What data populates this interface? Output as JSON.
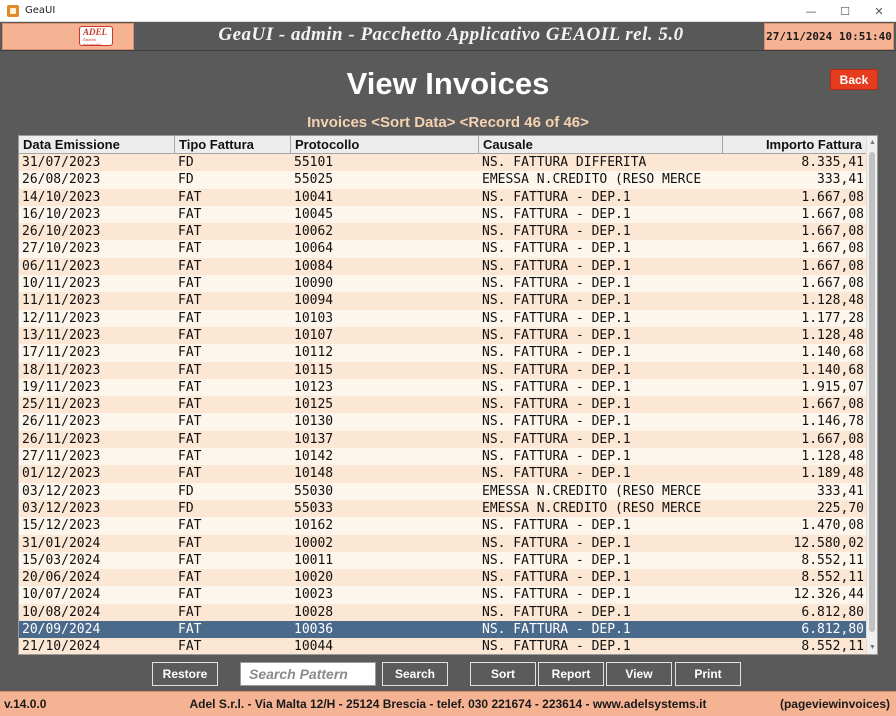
{
  "window": {
    "title": "GeaUI",
    "min": "—",
    "max": "☐",
    "close": "✕"
  },
  "header": {
    "logo_text": "ADEL",
    "logo_sub": "Sistemi Informativi",
    "app_title": "GeaUI - admin - Pacchetto Applicativo GEAOIL rel. 5.0",
    "datetime": "27/11/2024 10:51:40"
  },
  "page": {
    "title": "View Invoices",
    "back_label": "Back",
    "subtitle": "Invoices <Sort Data> <Record 46 of  46>"
  },
  "table": {
    "columns": [
      "Data Emissione",
      "Tipo Fattura",
      "Protocollo",
      "Causale",
      "Importo Fattura"
    ],
    "rows": [
      [
        "31/07/2023",
        "FD",
        "55101",
        "NS. FATTURA DIFFERITA",
        "8.335,41"
      ],
      [
        "26/08/2023",
        "FD",
        "55025",
        "EMESSA N.CREDITO (RESO MERCE",
        "333,41"
      ],
      [
        "14/10/2023",
        "FAT",
        "10041",
        "NS. FATTURA - DEP.1",
        "1.667,08"
      ],
      [
        "16/10/2023",
        "FAT",
        "10045",
        "NS. FATTURA - DEP.1",
        "1.667,08"
      ],
      [
        "26/10/2023",
        "FAT",
        "10062",
        "NS. FATTURA - DEP.1",
        "1.667,08"
      ],
      [
        "27/10/2023",
        "FAT",
        "10064",
        "NS. FATTURA - DEP.1",
        "1.667,08"
      ],
      [
        "06/11/2023",
        "FAT",
        "10084",
        "NS. FATTURA - DEP.1",
        "1.667,08"
      ],
      [
        "10/11/2023",
        "FAT",
        "10090",
        "NS. FATTURA - DEP.1",
        "1.667,08"
      ],
      [
        "11/11/2023",
        "FAT",
        "10094",
        "NS. FATTURA - DEP.1",
        "1.128,48"
      ],
      [
        "12/11/2023",
        "FAT",
        "10103",
        "NS. FATTURA - DEP.1",
        "1.177,28"
      ],
      [
        "13/11/2023",
        "FAT",
        "10107",
        "NS. FATTURA - DEP.1",
        "1.128,48"
      ],
      [
        "17/11/2023",
        "FAT",
        "10112",
        "NS. FATTURA - DEP.1",
        "1.140,68"
      ],
      [
        "18/11/2023",
        "FAT",
        "10115",
        "NS. FATTURA - DEP.1",
        "1.140,68"
      ],
      [
        "19/11/2023",
        "FAT",
        "10123",
        "NS. FATTURA - DEP.1",
        "1.915,07"
      ],
      [
        "25/11/2023",
        "FAT",
        "10125",
        "NS. FATTURA - DEP.1",
        "1.667,08"
      ],
      [
        "26/11/2023",
        "FAT",
        "10130",
        "NS. FATTURA - DEP.1",
        "1.146,78"
      ],
      [
        "26/11/2023",
        "FAT",
        "10137",
        "NS. FATTURA - DEP.1",
        "1.667,08"
      ],
      [
        "27/11/2023",
        "FAT",
        "10142",
        "NS. FATTURA - DEP.1",
        "1.128,48"
      ],
      [
        "01/12/2023",
        "FAT",
        "10148",
        "NS. FATTURA - DEP.1",
        "1.189,48"
      ],
      [
        "03/12/2023",
        "FD",
        "55030",
        "EMESSA N.CREDITO (RESO MERCE",
        "333,41"
      ],
      [
        "03/12/2023",
        "FD",
        "55033",
        "EMESSA N.CREDITO (RESO MERCE",
        "225,70"
      ],
      [
        "15/12/2023",
        "FAT",
        "10162",
        "NS. FATTURA - DEP.1",
        "1.470,08"
      ],
      [
        "31/01/2024",
        "FAT",
        "10002",
        "NS. FATTURA - DEP.1",
        "12.580,02"
      ],
      [
        "15/03/2024",
        "FAT",
        "10011",
        "NS. FATTURA - DEP.1",
        "8.552,11"
      ],
      [
        "20/06/2024",
        "FAT",
        "10020",
        "NS. FATTURA - DEP.1",
        "8.552,11"
      ],
      [
        "10/07/2024",
        "FAT",
        "10023",
        "NS. FATTURA - DEP.1",
        "12.326,44"
      ],
      [
        "10/08/2024",
        "FAT",
        "10028",
        "NS. FATTURA - DEP.1",
        "6.812,80"
      ],
      [
        "20/09/2024",
        "FAT",
        "10036",
        "NS. FATTURA - DEP.1",
        "6.812,80"
      ],
      [
        "21/10/2024",
        "FAT",
        "10044",
        "NS. FATTURA - DEP.1",
        "8.552,11"
      ]
    ],
    "selected_index": 27
  },
  "toolbar": {
    "restore": "Restore",
    "search_placeholder": "Search Pattern",
    "search": "Search",
    "sort": "Sort",
    "report": "Report",
    "view": "View",
    "print": "Print"
  },
  "footer": {
    "version": "v.14.0.0",
    "address": "Adel S.r.l. - Via Malta 12/H - 25124 Brescia - telef. 030 221674 - 223614 - www.adelsystems.it",
    "page_id": "(pageviewinvoices)"
  },
  "colors": {
    "accent": "#f6b394",
    "back": "#e53b1f",
    "row_odd": "#fce6d4",
    "row_even": "#fdf6ec",
    "row_selected": "#4a6a8c",
    "background": "#5a5a5a"
  }
}
